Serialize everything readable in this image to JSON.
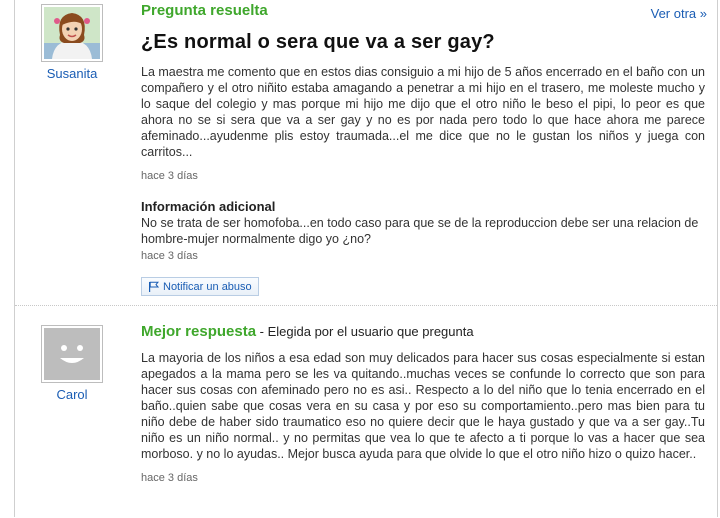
{
  "question": {
    "user_name": "Susanita",
    "status": "Pregunta resuelta",
    "more_link": "Ver otra »",
    "title": "¿Es normal o sera que va a ser gay?",
    "body": "La maestra me comento que en estos dias consiguio a mi hijo de 5 años encerrado en el baño con un compañero y el otro niñito estaba amagando a penetrar a mi hijo en el trasero, me moleste mucho y lo saque del colegio y mas porque mi hijo me dijo que el otro niño le beso el pipi, lo peor es que ahora no se si sera que va a ser gay y no es por nada pero todo lo que hace ahora me parece afeminado...ayudenme plis estoy traumada...el me dice que no le gustan los niños y juega con carritos...",
    "timestamp": "hace 3 días",
    "additional_heading": "Información adicional",
    "additional_text": "No se trata de ser homofoba...en todo caso para que se de la reproduccion debe ser una relacion de hombre-mujer normalmente digo yo ¿no?",
    "additional_timestamp": "hace 3 días",
    "report_label": "Notificar un abuso"
  },
  "answer": {
    "user_name": "Carol",
    "status": "Mejor respuesta",
    "chosen_by": " - Elegida por el usuario que pregunta",
    "body": "La mayoria de los niños a esa edad son muy delicados para hacer sus cosas especialmente si estan apegados a la mama pero se les va quitando..muchas veces se confunde lo correcto que son para hacer sus cosas con afeminado pero no es asi.. Respecto a lo del niño que lo tenia encerrado en el baño..quien sabe que cosas vera en su casa y por eso su comportamiento..pero mas bien para tu niño debe de haber sido traumatico eso no quiere decir que le haya gustado y que va a ser gay..Tu niño es un niño normal.. y no permitas que vea lo que te afecto a ti porque lo vas a hacer que sea morboso. y no lo ayudas.. Mejor busca ayuda para que olvide lo que el otro niño hizo o quizo hacer..",
    "timestamp": "hace 3 días"
  },
  "colors": {
    "status_green": "#3fa72c",
    "link_blue": "#1a5db4"
  },
  "icons": [
    "avatar-susanita",
    "avatar-default",
    "flag-icon"
  ]
}
